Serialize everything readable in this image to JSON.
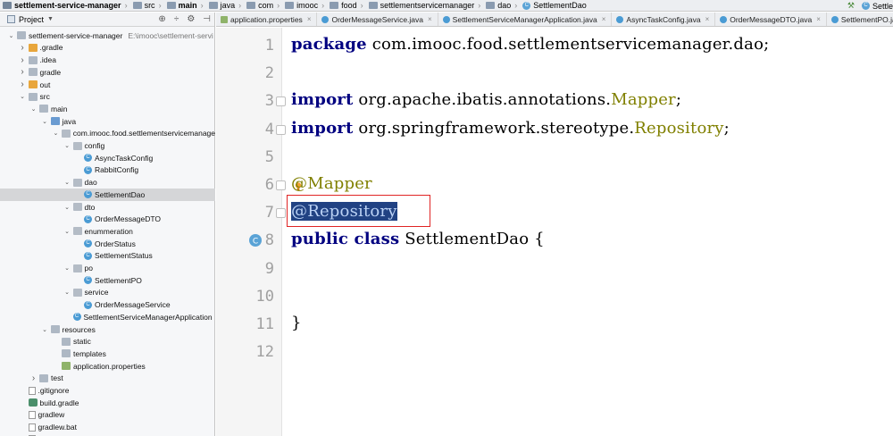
{
  "breadcrumb": {
    "items": [
      {
        "label": "settlement-service-manager",
        "bold": true
      },
      {
        "label": "src",
        "bold": false
      },
      {
        "label": "main",
        "bold": true
      },
      {
        "label": "java",
        "bold": false
      },
      {
        "label": "com",
        "bold": false
      },
      {
        "label": "imooc",
        "bold": false
      },
      {
        "label": "food",
        "bold": false
      },
      {
        "label": "settlementservicemanager",
        "bold": false
      },
      {
        "label": "dao",
        "bold": false
      },
      {
        "label": "SettlementDao",
        "bold": false
      }
    ],
    "right_label": "Settle"
  },
  "project_panel": {
    "title": "Project",
    "tree": [
      {
        "label": "settlement-service-manager",
        "path": "E:\\imooc\\settlement-servi",
        "depth": 0,
        "arrow": "down",
        "icon": "folder"
      },
      {
        "label": ".gradle",
        "depth": 1,
        "arrow": "right",
        "icon": "folder-orange"
      },
      {
        "label": ".idea",
        "depth": 1,
        "arrow": "right",
        "icon": "folder"
      },
      {
        "label": "gradle",
        "depth": 1,
        "arrow": "right",
        "icon": "folder"
      },
      {
        "label": "out",
        "depth": 1,
        "arrow": "right",
        "icon": "folder-orange"
      },
      {
        "label": "src",
        "depth": 1,
        "arrow": "down",
        "icon": "folder"
      },
      {
        "label": "main",
        "depth": 2,
        "arrow": "down",
        "icon": "folder"
      },
      {
        "label": "java",
        "depth": 3,
        "arrow": "down",
        "icon": "folder-blue"
      },
      {
        "label": "com.imooc.food.settlementservicemanage",
        "depth": 4,
        "arrow": "down",
        "icon": "folder-pkg"
      },
      {
        "label": "config",
        "depth": 5,
        "arrow": "down",
        "icon": "folder-pkg"
      },
      {
        "label": "AsyncTaskConfig",
        "depth": 6,
        "arrow": "",
        "icon": "class"
      },
      {
        "label": "RabbitConfig",
        "depth": 6,
        "arrow": "",
        "icon": "class"
      },
      {
        "label": "dao",
        "depth": 5,
        "arrow": "down",
        "icon": "folder-pkg"
      },
      {
        "label": "SettlementDao",
        "depth": 6,
        "arrow": "",
        "icon": "class",
        "selected": true
      },
      {
        "label": "dto",
        "depth": 5,
        "arrow": "down",
        "icon": "folder-pkg"
      },
      {
        "label": "OrderMessageDTO",
        "depth": 6,
        "arrow": "",
        "icon": "class"
      },
      {
        "label": "enummeration",
        "depth": 5,
        "arrow": "down",
        "icon": "folder-pkg"
      },
      {
        "label": "OrderStatus",
        "depth": 6,
        "arrow": "",
        "icon": "class"
      },
      {
        "label": "SettlementStatus",
        "depth": 6,
        "arrow": "",
        "icon": "class"
      },
      {
        "label": "po",
        "depth": 5,
        "arrow": "down",
        "icon": "folder-pkg"
      },
      {
        "label": "SettlementPO",
        "depth": 6,
        "arrow": "",
        "icon": "class"
      },
      {
        "label": "service",
        "depth": 5,
        "arrow": "down",
        "icon": "folder-pkg"
      },
      {
        "label": "OrderMessageService",
        "depth": 6,
        "arrow": "",
        "icon": "class"
      },
      {
        "label": "SettlementServiceManagerApplication",
        "depth": 5,
        "arrow": "",
        "icon": "class"
      },
      {
        "label": "resources",
        "depth": 3,
        "arrow": "down",
        "icon": "folder"
      },
      {
        "label": "static",
        "depth": 4,
        "arrow": "",
        "icon": "folder"
      },
      {
        "label": "templates",
        "depth": 4,
        "arrow": "",
        "icon": "folder"
      },
      {
        "label": "application.properties",
        "depth": 4,
        "arrow": "",
        "icon": "props"
      },
      {
        "label": "test",
        "depth": 2,
        "arrow": "right",
        "icon": "folder"
      },
      {
        "label": ".gitignore",
        "depth": 1,
        "arrow": "",
        "icon": "file"
      },
      {
        "label": "build.gradle",
        "depth": 1,
        "arrow": "",
        "icon": "gradle"
      },
      {
        "label": "gradlew",
        "depth": 1,
        "arrow": "",
        "icon": "file"
      },
      {
        "label": "gradlew.bat",
        "depth": 1,
        "arrow": "",
        "icon": "file"
      },
      {
        "label": "HELP.md",
        "depth": 1,
        "arrow": "",
        "icon": "file"
      }
    ]
  },
  "tabs": [
    {
      "label": "application.properties",
      "icon": "props"
    },
    {
      "label": "OrderMessageService.java",
      "icon": "class"
    },
    {
      "label": "SettlementServiceManagerApplication.java",
      "icon": "class"
    },
    {
      "label": "AsyncTaskConfig.java",
      "icon": "class"
    },
    {
      "label": "OrderMessageDTO.java",
      "icon": "class"
    },
    {
      "label": "SettlementPO.java",
      "icon": "class"
    }
  ],
  "editor": {
    "lines": [
      {
        "n": "1",
        "segments": [
          {
            "t": "package",
            "c": "kw"
          },
          {
            "t": " com.imooc.food.settlementservicemanager.dao;",
            "c": "plain"
          }
        ]
      },
      {
        "n": "2",
        "segments": []
      },
      {
        "n": "3",
        "segments": [
          {
            "t": "import",
            "c": "kw"
          },
          {
            "t": " org.apache.ibatis.annotations.",
            "c": "plain"
          },
          {
            "t": "Mapper",
            "c": "ann"
          },
          {
            "t": ";",
            "c": "plain"
          }
        ]
      },
      {
        "n": "4",
        "segments": [
          {
            "t": "import",
            "c": "kw"
          },
          {
            "t": " org.springframework.stereotype.",
            "c": "plain"
          },
          {
            "t": "Repository",
            "c": "ann"
          },
          {
            "t": ";",
            "c": "plain"
          }
        ]
      },
      {
        "n": "5",
        "segments": []
      },
      {
        "n": "6",
        "segments": [
          {
            "t": "@Mapper",
            "c": "ann"
          }
        ]
      },
      {
        "n": "7",
        "segments": [
          {
            "t": "@Repository",
            "c": "sel"
          }
        ]
      },
      {
        "n": "8",
        "segments": [
          {
            "t": "public class",
            "c": "kw"
          },
          {
            "t": " SettlementDao {",
            "c": "plain"
          }
        ]
      },
      {
        "n": "9",
        "segments": []
      },
      {
        "n": "10",
        "segments": []
      },
      {
        "n": "11",
        "segments": [
          {
            "t": "}",
            "c": "plain"
          }
        ]
      },
      {
        "n": "12",
        "segments": []
      }
    ]
  },
  "colors": {
    "keyword": "#000080",
    "annotation": "#808000",
    "selection": "#214283",
    "highlight_box": "#e02424",
    "line_number": "#a0a0a0"
  }
}
